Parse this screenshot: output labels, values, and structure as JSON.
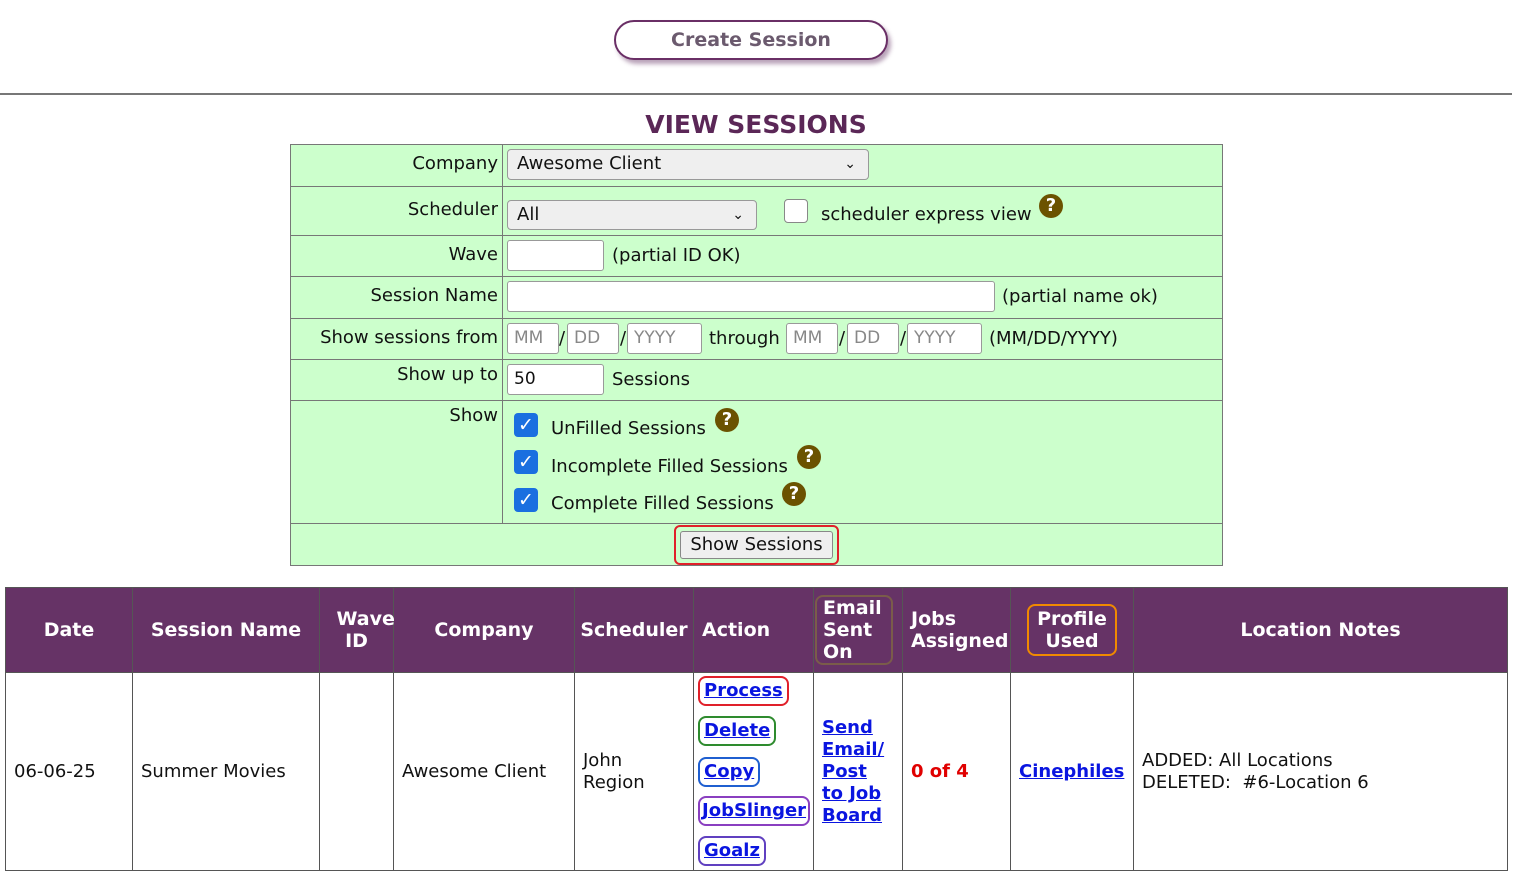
{
  "top": {
    "create_session_label": "Create Session"
  },
  "view_title": "VIEW SESSIONS",
  "filter": {
    "company_label": "Company",
    "company_value": "Awesome Client",
    "scheduler_label": "Scheduler",
    "scheduler_value": "All",
    "express_view_label": "scheduler express view",
    "wave_label": "Wave",
    "wave_hint": "(partial ID OK)",
    "session_name_label": "Session Name",
    "session_name_hint": "(partial name ok)",
    "show_from_label": "Show sessions from",
    "mm_ph": "MM",
    "dd_ph": "DD",
    "yyyy_ph": "YYYY",
    "slash": "/",
    "through_label": "through",
    "date_format_hint": "(MM/DD/YYYY)",
    "show_up_to_label": "Show up to",
    "show_up_to_value": "50",
    "sessions_suffix": "Sessions",
    "show_label": "Show",
    "unfilled_label": "UnFilled Sessions",
    "incomplete_label": "Incomplete Filled Sessions",
    "complete_label": "Complete Filled Sessions",
    "show_sessions_button": "Show Sessions"
  },
  "table": {
    "headers": {
      "date": "Date",
      "session_name": "Session Name",
      "wave_id": "Wave ID",
      "company": "Company",
      "scheduler": "Scheduler",
      "action": "Action",
      "email_sent_on": "Email Sent On",
      "jobs_assigned": "Jobs Assigned",
      "profile_used": "Profile Used",
      "location_notes": "Location Notes"
    },
    "row": {
      "date": "06-06-25",
      "session_name": "Summer Movies",
      "wave_id": "",
      "company": "Awesome Client",
      "scheduler_line1": "John",
      "scheduler_line2": "Region",
      "actions": [
        "Process",
        "Delete",
        "Copy",
        "JobSlinger",
        "Goalz"
      ],
      "email_link_lines": [
        "Send",
        "Email/",
        "Post",
        "to Job",
        "Board"
      ],
      "jobs_assigned": "0 of 4",
      "profile_used": "Cinephiles",
      "notes_line1": "ADDED: All Locations",
      "notes_line2": "DELETED:  #6-Location 6"
    }
  },
  "colors": {
    "header_bg": "#663366",
    "filter_bg": "#ccffcc",
    "link": "#0a15e0",
    "jobs_red": "#e00000",
    "highlight_red": "#e0202a",
    "highlight_green": "#2e8b2e",
    "highlight_blue": "#1f5fd0",
    "highlight_purple": "#8a3fc0",
    "highlight_brown": "#7a5c4a",
    "highlight_orange": "#f08a00"
  },
  "icons": {
    "help": "question-circle-icon",
    "check": "checkmark-icon",
    "chevron": "chevron-down-icon"
  }
}
